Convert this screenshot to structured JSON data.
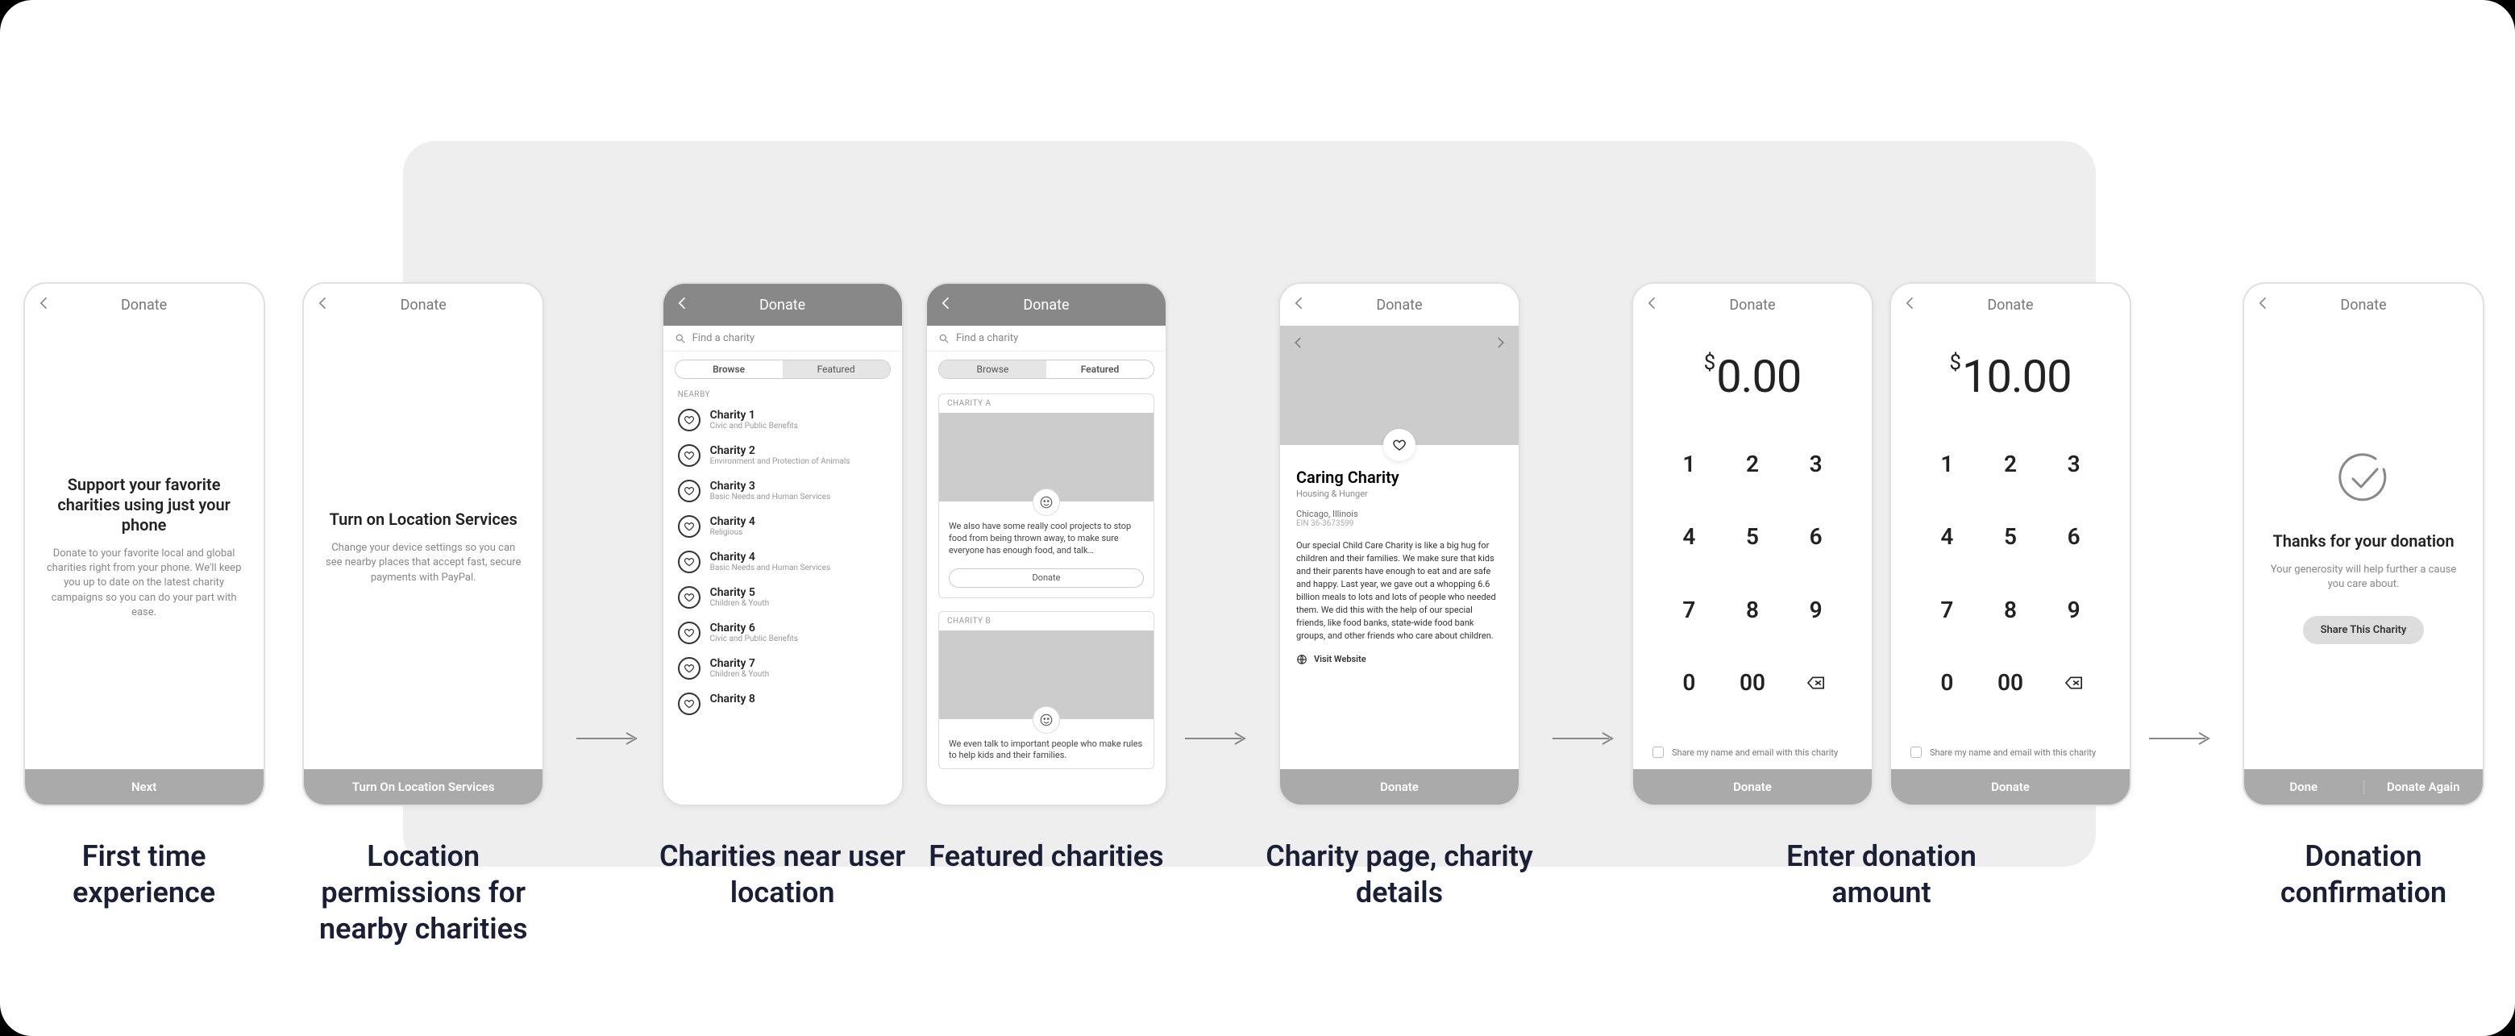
{
  "labels": {
    "s1": "First time experience",
    "s2": "Location permissions for nearby charities",
    "s3": "Charities near user location",
    "s4": "Featured charities",
    "s5": "Charity page, charity details",
    "s6": "Enter donation amount",
    "s7": "Donation confirmation"
  },
  "common": {
    "header": "Donate",
    "donate_btn": "Donate"
  },
  "screen1": {
    "title": "Support your favorite charities using just your phone",
    "body": "Donate to your favorite local and global charities right from your phone. We'll keep you up to date on the latest charity campaigns so you can do your part with ease.",
    "cta": "Next"
  },
  "screen2": {
    "title": "Turn on Location Services",
    "body": "Change your device settings so you can see nearby places that accept fast, secure payments with PayPal.",
    "cta": "Turn On Location Services"
  },
  "screen3": {
    "search": "Find a charity",
    "tabs": {
      "browse": "Browse",
      "featured": "Featured"
    },
    "section": "NEARBY",
    "items": [
      {
        "name": "Charity 1",
        "cat": "Civic and Public Benefits"
      },
      {
        "name": "Charity 2",
        "cat": "Environment and Protection of Animals"
      },
      {
        "name": "Charity 3",
        "cat": "Basic Needs and Human Services"
      },
      {
        "name": "Charity 4",
        "cat": "Religious"
      },
      {
        "name": "Charity 4",
        "cat": "Basic Needs and Human Services"
      },
      {
        "name": "Charity 5",
        "cat": "Children & Youth"
      },
      {
        "name": "Charity 6",
        "cat": "Civic and Public Benefits"
      },
      {
        "name": "Charity 7",
        "cat": "Children & Youth"
      },
      {
        "name": "Charity 8",
        "cat": ""
      }
    ]
  },
  "screen4": {
    "search": "Find a charity",
    "tabs": {
      "browse": "Browse",
      "featured": "Featured"
    },
    "cardA": {
      "hdr": "CHARITY A",
      "desc": "We also have some really cool projects to stop food from being thrown away, to make sure everyone has enough food, and talk…",
      "btn": "Donate"
    },
    "cardB": {
      "hdr": "CHARITY B",
      "desc": "We even talk to important people who make rules to help kids and their families."
    }
  },
  "screen5": {
    "name": "Caring Charity",
    "cat": "Housing & Hunger",
    "loc": "Chicago, Illinois",
    "ein": "EIN 36-3673599",
    "story": "Our special Child Care Charity is like a big hug for children and their families. We make sure that kids and their parents have enough to eat and are safe and happy. Last year, we gave out a whopping 6.6 billion meals to lots and lots of people who needed them. We did this with the help of our special friends, like food banks, state-wide food bank groups, and other friends who care about children.",
    "visit": "Visit Website"
  },
  "screen6": {
    "amountA": "0.00",
    "amountB": "10.00",
    "keys": [
      "1",
      "2",
      "3",
      "4",
      "5",
      "6",
      "7",
      "8",
      "9",
      "0",
      "00"
    ],
    "share": "Share my name and email with this charity"
  },
  "screen7": {
    "title": "Thanks for your donation",
    "body": "Your generosity will help further a cause you care about.",
    "share": "Share This Charity",
    "done": "Done",
    "again": "Donate Again"
  }
}
